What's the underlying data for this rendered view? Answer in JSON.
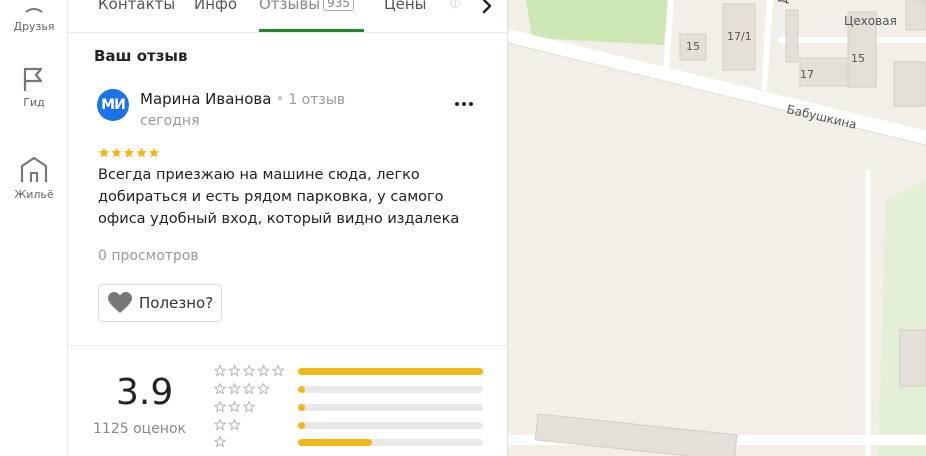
{
  "rail": {
    "items": [
      {
        "label": "Друзья",
        "icon": "people-icon"
      },
      {
        "label": "Гид",
        "icon": "flag-icon"
      },
      {
        "label": "Жильё",
        "icon": "house-icon"
      }
    ]
  },
  "tabs": [
    {
      "label": "Контакты"
    },
    {
      "label": "Инфо"
    },
    {
      "label": "Отзывы",
      "count": "935",
      "active": true
    },
    {
      "label": "Цены"
    },
    {
      "label": "Ф"
    }
  ],
  "review_section": {
    "title": "Ваш отзыв",
    "avatar_initials": "МИ",
    "author": "Марина Иванова",
    "author_reviews": "1 отзыв",
    "separator": "•",
    "date": "сегодня",
    "stars": 5,
    "text": "Всегда приезжаю на машине сюда, легко добираться и есть рядом парковка, у самого офиса удобный вход, который видно издалека",
    "views": "0 просмотров",
    "helpful_label": "Полезно?"
  },
  "rating": {
    "value": "3.9",
    "count_label": "1125 оценок",
    "distribution": [
      {
        "stars": 5,
        "fraction": 1.0
      },
      {
        "stars": 4,
        "fraction": 0.04
      },
      {
        "stars": 3,
        "fraction": 0.04
      },
      {
        "stars": 2,
        "fraction": 0.04
      },
      {
        "stars": 1,
        "fraction": 0.4
      }
    ]
  },
  "map": {
    "street_labels": [
      "Бабушкина",
      "Цеховая",
      "Да"
    ],
    "house_numbers": [
      "15",
      "17/1",
      "17",
      "15"
    ]
  },
  "colors": {
    "accent_green": "#1f8a2c",
    "star_yellow": "#f5b619",
    "avatar_blue": "#1a73e8",
    "map_park": "#cde8b5"
  }
}
